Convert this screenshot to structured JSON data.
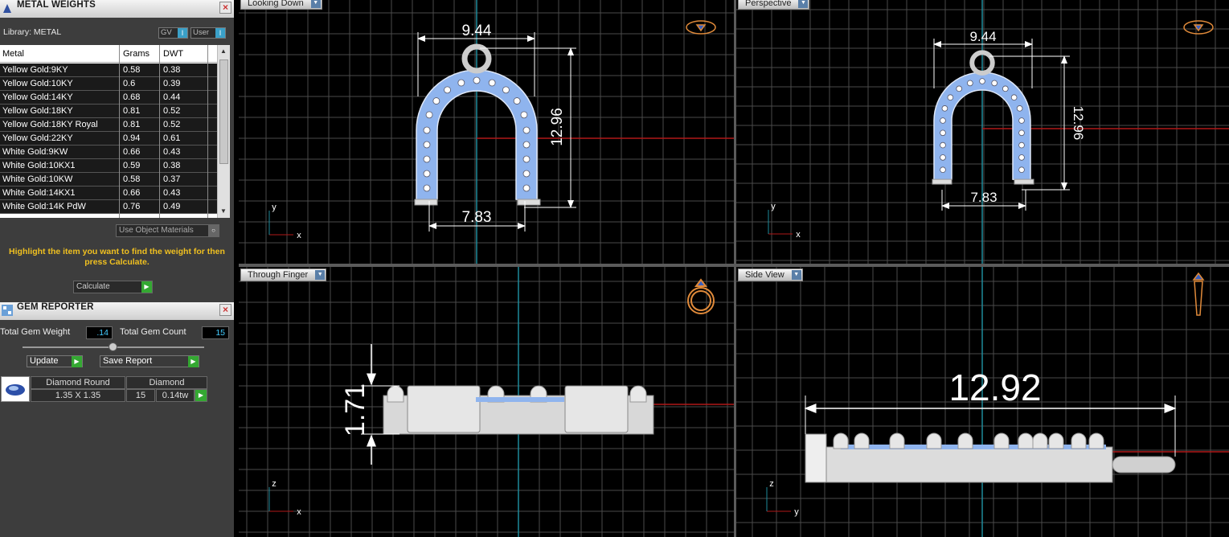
{
  "metal_weights": {
    "title": "METAL WEIGHTS",
    "library_label": "Library: METAL",
    "gv_label": "GV",
    "user_label": "User",
    "columns": [
      "Metal",
      "Grams",
      "DWT"
    ],
    "rows": [
      {
        "metal": "Yellow Gold:9KY",
        "grams": "0.58",
        "dwt": "0.38"
      },
      {
        "metal": "Yellow Gold:10KY",
        "grams": "0.6",
        "dwt": "0.39"
      },
      {
        "metal": "Yellow Gold:14KY",
        "grams": "0.68",
        "dwt": "0.44"
      },
      {
        "metal": "Yellow Gold:18KY",
        "grams": "0.81",
        "dwt": "0.52"
      },
      {
        "metal": "Yellow Gold:18KY Royal",
        "grams": "0.81",
        "dwt": "0.52"
      },
      {
        "metal": "Yellow Gold:22KY",
        "grams": "0.94",
        "dwt": "0.61"
      },
      {
        "metal": "White Gold:9KW",
        "grams": "0.66",
        "dwt": "0.43"
      },
      {
        "metal": "White Gold:10KX1",
        "grams": "0.59",
        "dwt": "0.38"
      },
      {
        "metal": "White Gold:10KW",
        "grams": "0.58",
        "dwt": "0.37"
      },
      {
        "metal": "White Gold:14KX1",
        "grams": "0.66",
        "dwt": "0.43"
      },
      {
        "metal": "White Gold:14K PdW",
        "grams": "0.76",
        "dwt": "0.49"
      }
    ],
    "use_object_materials": "Use Object Materials",
    "hint": "Highlight the item you want to find the weight for then press Calculate.",
    "calculate_label": "Calculate"
  },
  "gem_reporter": {
    "title": "GEM REPORTER",
    "total_weight_label": "Total Gem Weight",
    "total_weight_value": ".14",
    "total_count_label": "Total Gem Count",
    "total_count_value": "15",
    "update_label": "Update",
    "save_report_label": "Save Report",
    "gem": {
      "shape": "Diamond Round",
      "type": "Diamond",
      "size": "1.35 X 1.35",
      "count": "15",
      "weight": "0.14tw"
    }
  },
  "viewports": {
    "top_left": {
      "name": "Looking Down",
      "width_dim": "9.44",
      "height_dim": "12.96",
      "bottom_dim": "7.83"
    },
    "top_right": {
      "name": "Perspective",
      "width_dim": "9.44",
      "height_dim": "12.96",
      "bottom_dim": "7.83"
    },
    "bottom_left": {
      "name": "Through Finger",
      "thickness_dim": "1.71"
    },
    "bottom_right": {
      "name": "Side View",
      "length_dim": "12.92"
    }
  },
  "axes": {
    "x": "x",
    "y": "y",
    "z": "z"
  },
  "colors": {
    "grid": "#4a4a4a",
    "axis_red": "#b01818",
    "axis_cyan": "#1e8a9a",
    "gem_blue": "#8fb4ee",
    "hint_yellow": "#f0c020"
  }
}
